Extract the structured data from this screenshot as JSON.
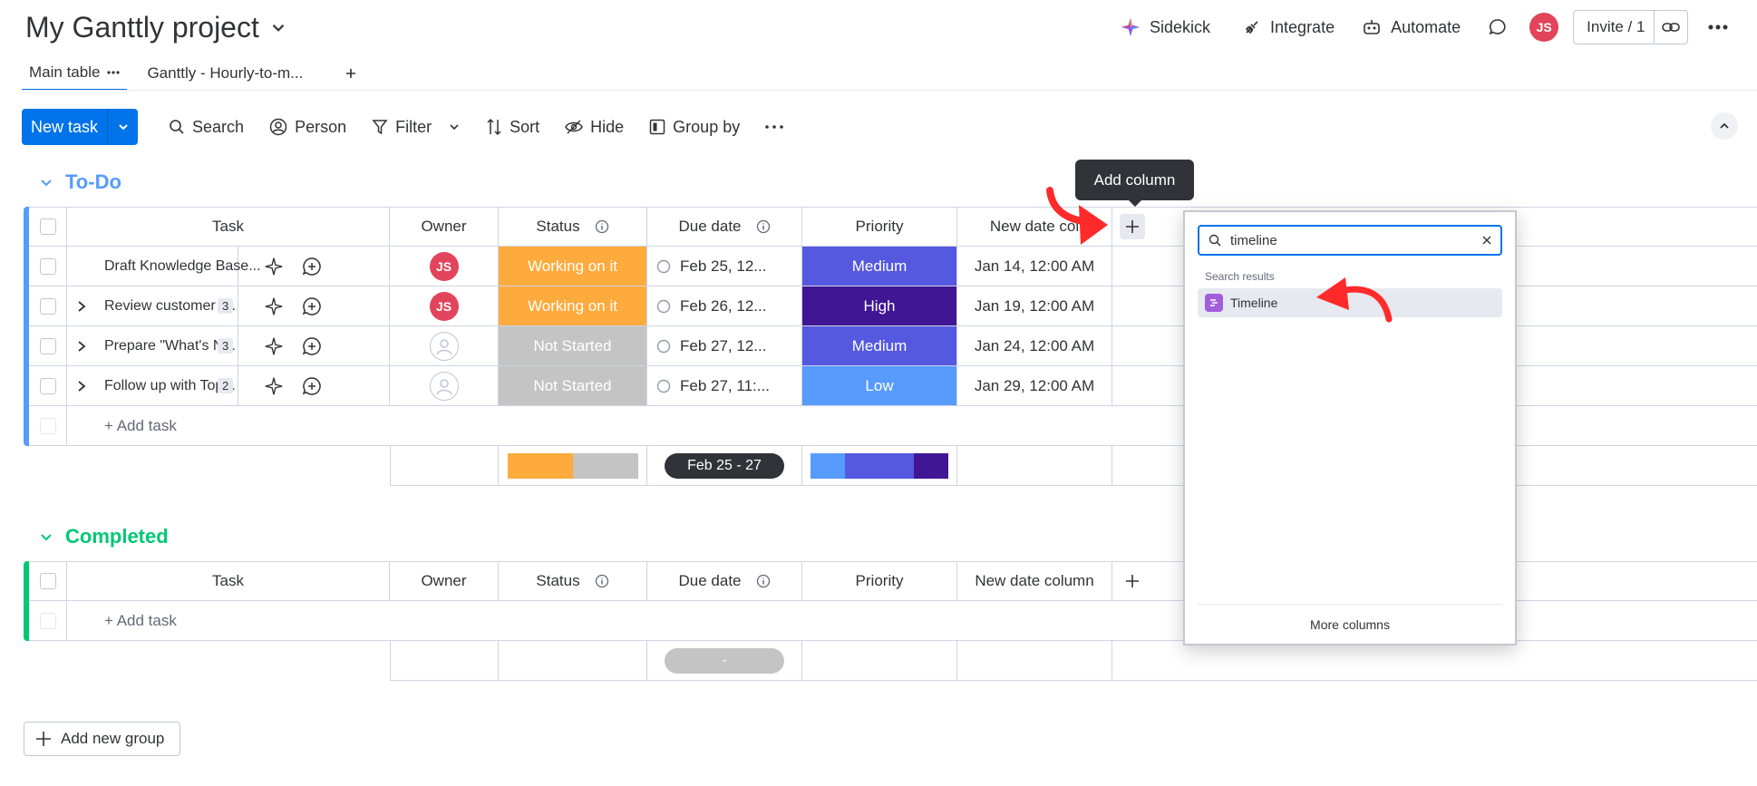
{
  "header": {
    "title": "My Ganttly project",
    "sidekick": "Sidekick",
    "integrate": "Integrate",
    "automate": "Automate",
    "avatar_initials": "JS",
    "invite": "Invite / 1"
  },
  "tabs": [
    {
      "label": "Main table"
    },
    {
      "label": "Ganttly - Hourly-to-m..."
    }
  ],
  "toolbar": {
    "new_task": "New task",
    "search": "Search",
    "person": "Person",
    "filter": "Filter",
    "sort": "Sort",
    "hide": "Hide",
    "group_by": "Group by"
  },
  "columns": {
    "task": "Task",
    "owner": "Owner",
    "status": "Status",
    "due_date": "Due date",
    "priority": "Priority",
    "new_date": "New date column",
    "new_date_truncated": "New date col"
  },
  "groups": {
    "todo": {
      "title": "To-Do",
      "color": "#579bfc",
      "rows": [
        {
          "task": "Draft Knowledge Base...",
          "subitems": "",
          "owner": "JS",
          "status": "Working on it",
          "status_color": "#fdab3d",
          "due": "Feb 25, 12...",
          "priority": "Medium",
          "priority_color": "#5559df",
          "new_date": "Jan 14, 12:00 AM"
        },
        {
          "task": "Review customer f...",
          "subitems": "3",
          "owner": "JS",
          "status": "Working on it",
          "status_color": "#fdab3d",
          "due": "Feb 26, 12...",
          "priority": "High",
          "priority_color": "#401694",
          "new_date": "Jan 19, 12:00 AM"
        },
        {
          "task": "Prepare \"What's N...",
          "subitems": "3",
          "owner": "",
          "status": "Not Started",
          "status_color": "#c4c4c4",
          "due": "Feb 27, 12...",
          "priority": "Medium",
          "priority_color": "#5559df",
          "new_date": "Jan 24, 12:00 AM"
        },
        {
          "task": "Follow up with Top...",
          "subitems": "2",
          "owner": "",
          "status": "Not Started",
          "status_color": "#c4c4c4",
          "due": "Feb 27, 11:...",
          "priority": "Low",
          "priority_color": "#579bfc",
          "new_date": "Jan 29, 12:00 AM"
        }
      ],
      "add_task": "+ Add task",
      "summary_due": "Feb 25 - 27"
    },
    "completed": {
      "title": "Completed",
      "color": "#00c875",
      "add_task": "+ Add task",
      "summary_due": "-"
    }
  },
  "tooltip": "Add column",
  "panel": {
    "search_value": "timeline",
    "results_label": "Search results",
    "result": "Timeline",
    "footer": "More columns"
  },
  "add_group": "Add new group"
}
